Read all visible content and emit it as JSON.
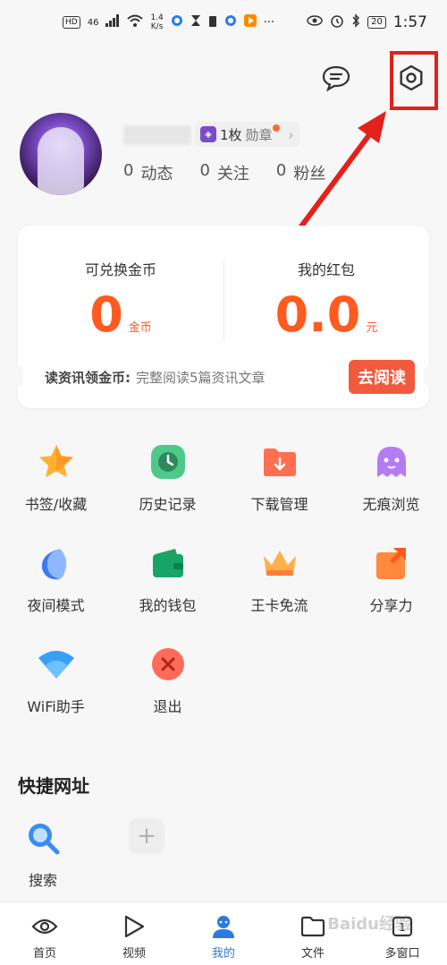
{
  "status_bar": {
    "hd": "HD",
    "signal": "46",
    "speed_top": "1.4",
    "speed_bottom": "K/s",
    "dots": "···",
    "battery": "20",
    "time": "1:57"
  },
  "header": {
    "message_icon": "chat-bubble-icon",
    "settings_icon": "hexagon-settings-icon",
    "highlight_color": "#e3201b"
  },
  "profile": {
    "medal_count": "1枚",
    "medal_label": "勋章",
    "stats": [
      {
        "value": "0",
        "label": "动态"
      },
      {
        "value": "0",
        "label": "关注"
      },
      {
        "value": "0",
        "label": "粉丝"
      }
    ]
  },
  "rewards": {
    "coins_label": "可兑换金币",
    "coins_value": "0",
    "coins_unit": "金币",
    "redpacket_label": "我的红包",
    "redpacket_value": "0.0",
    "redpacket_unit": "元",
    "task_lead": "读资讯领金币:",
    "task_desc": "完整阅读5篇资讯文章",
    "task_button": "去阅读",
    "accent_color": "#ff5a1f"
  },
  "grid": {
    "items": [
      {
        "label": "书签/收藏",
        "icon": "star-icon"
      },
      {
        "label": "历史记录",
        "icon": "clock-icon"
      },
      {
        "label": "下载管理",
        "icon": "download-folder-icon"
      },
      {
        "label": "无痕浏览",
        "icon": "ghost-icon"
      },
      {
        "label": "夜间模式",
        "icon": "moon-icon"
      },
      {
        "label": "我的钱包",
        "icon": "wallet-icon"
      },
      {
        "label": "王卡免流",
        "icon": "crown-icon"
      },
      {
        "label": "分享力",
        "icon": "share-icon"
      },
      {
        "label": "WiFi助手",
        "icon": "wifi-icon"
      },
      {
        "label": "退出",
        "icon": "exit-icon"
      }
    ]
  },
  "quick_links": {
    "title": "快捷网址",
    "items": [
      {
        "label": "搜索",
        "icon": "search-icon"
      },
      {
        "label": "",
        "icon": "add-icon"
      }
    ]
  },
  "bottom_nav": {
    "items": [
      {
        "label": "首页",
        "icon": "eye-icon"
      },
      {
        "label": "视频",
        "icon": "play-icon"
      },
      {
        "label": "我的",
        "icon": "user-icon"
      },
      {
        "label": "文件",
        "icon": "folder-icon"
      },
      {
        "label": "多窗口",
        "icon": "window-icon"
      }
    ],
    "active": "我的",
    "active_color": "#2a7ae2"
  },
  "watermark": "Baidu经验"
}
